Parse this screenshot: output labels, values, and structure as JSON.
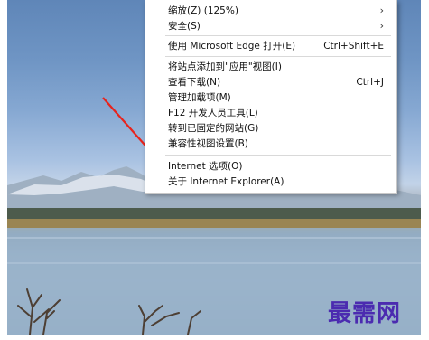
{
  "menu": {
    "items": [
      {
        "label": "缩放(Z) (125%)",
        "shortcut": "",
        "submenu": "›"
      },
      {
        "label": "安全(S)",
        "shortcut": "",
        "submenu": "›"
      },
      {
        "label": "使用 Microsoft Edge 打开(E)",
        "shortcut": "Ctrl+Shift+E",
        "submenu": ""
      },
      {
        "label": "将站点添加到\"应用\"视图(I)",
        "shortcut": "",
        "submenu": ""
      },
      {
        "label": "查看下载(N)",
        "shortcut": "Ctrl+J",
        "submenu": ""
      },
      {
        "label": "管理加载项(M)",
        "shortcut": "",
        "submenu": ""
      },
      {
        "label": "F12 开发人员工具(L)",
        "shortcut": "",
        "submenu": ""
      },
      {
        "label": "转到已固定的网站(G)",
        "shortcut": "",
        "submenu": ""
      },
      {
        "label": "兼容性视图设置(B)",
        "shortcut": "",
        "submenu": ""
      },
      {
        "label": "Internet 选项(O)",
        "shortcut": "",
        "submenu": ""
      },
      {
        "label": "关于 Internet Explorer(A)",
        "shortcut": "",
        "submenu": ""
      }
    ]
  },
  "watermark": {
    "text": "最需网"
  },
  "colors": {
    "annotation_arrow": "#e8231c",
    "watermark": "#4b2bb0"
  }
}
